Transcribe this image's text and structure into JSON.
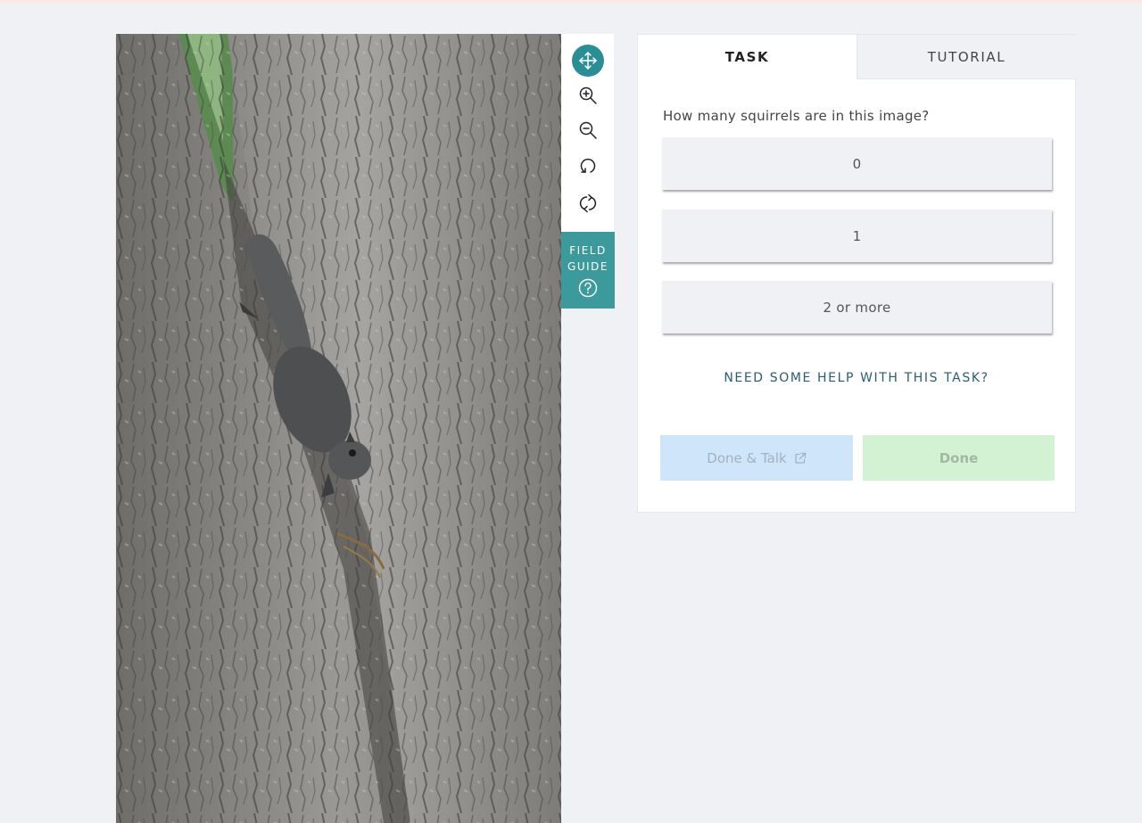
{
  "subject": {
    "alt": "Photo of a grey squirrel on a tree trunk"
  },
  "toolbar": {
    "tools": [
      {
        "name": "move",
        "icon": "move-icon",
        "active": true
      },
      {
        "name": "zoom-in",
        "icon": "zoom-in-icon",
        "active": false
      },
      {
        "name": "zoom-out",
        "icon": "zoom-out-icon",
        "active": false
      },
      {
        "name": "rotate",
        "icon": "rotate-icon",
        "active": false
      },
      {
        "name": "reset",
        "icon": "reset-icon",
        "active": false
      }
    ],
    "field_guide": {
      "label_line1": "FIELD",
      "label_line2": "GUIDE",
      "icon": "help-circle-icon"
    }
  },
  "tabs": {
    "task": "TASK",
    "tutorial": "TUTORIAL",
    "active": "task"
  },
  "task": {
    "question": "How many squirrels are in this image?",
    "answers": [
      "0",
      "1",
      "2 or more"
    ],
    "help_link": "NEED SOME HELP WITH THIS TASK?"
  },
  "actions": {
    "done_talk": "Done & Talk",
    "done_talk_icon": "external-link-icon",
    "done": "Done"
  },
  "colors": {
    "accent": "#2b8e94",
    "field_guide": "#3c9a9d",
    "help_link": "#2a5c72",
    "done_talk_bg": "#cfe6fa",
    "done_bg": "#d3f2d3",
    "page_bg": "#eff1f4"
  }
}
